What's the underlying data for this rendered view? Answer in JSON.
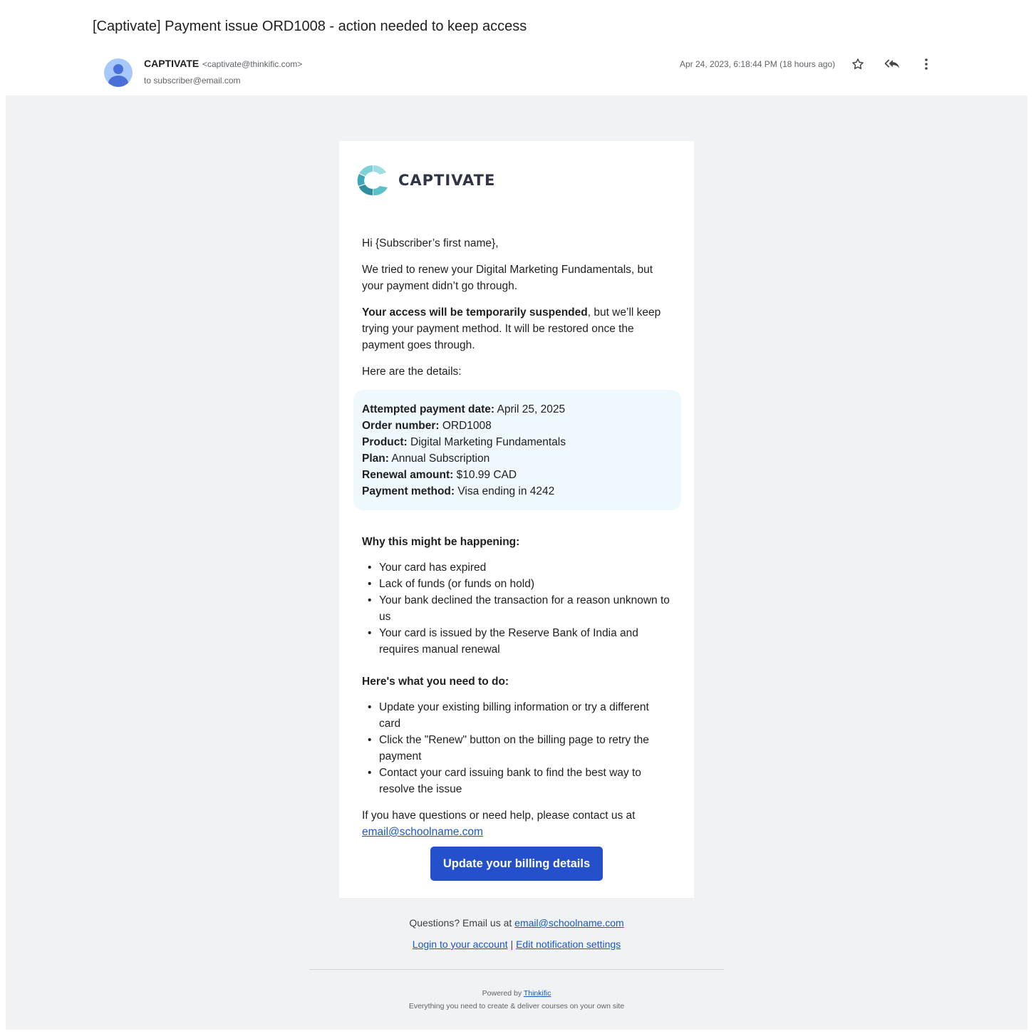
{
  "email": {
    "subject": "[Captivate] Payment issue ORD1008 - action needed to keep access",
    "sender_name": "CAPTIVATE",
    "sender_email": "<captivate@thinkific.com>",
    "to_line": "to subscriber@email.com",
    "date": "Apr 24, 2023, 6:18:44 PM (18 hours ago)",
    "icons": [
      "person-avatar-icon",
      "star-icon",
      "reply-all-icon",
      "more-vertical-icon"
    ]
  },
  "brand": {
    "name": "CAPTIVATE",
    "colors": {
      "logo_teal": "#5cc0c9",
      "logo_dark": "#2f8fa0",
      "button": "#2450cc",
      "link": "#1a56c9",
      "details_bg": "#eef8fd"
    }
  },
  "body": {
    "greeting": "Hi {Subscriber’s first name},",
    "intro": "We tried to renew your Digital Marketing Fundamentals, but your payment didn’t go through.",
    "access_bold": "Your access will be temporarily suspended",
    "access_rest": ", but we’ll keep trying your payment method. It will be restored once the payment goes through.",
    "details_intro": "Here are the details:",
    "details": [
      {
        "label": "Attempted payment date:",
        "value": " April 25, 2025"
      },
      {
        "label": "Order number:",
        "value": " ORD1008"
      },
      {
        "label": "Product:",
        "value": " Digital Marketing Fundamentals"
      },
      {
        "label": "Plan:",
        "value": " Annual Subscription"
      },
      {
        "label": "Renewal amount:",
        "value": " $10.99 CAD"
      },
      {
        "label": "Payment method:",
        "value": " Visa ending in 4242"
      }
    ],
    "why_heading": "Why this might be happening:",
    "why_items": [
      "Your card has expired",
      "Lack of funds (or funds on hold)",
      "Your bank declined the transaction for a reason unknown to us",
      "Your card is issued by the Reserve Bank of India and requires manual renewal"
    ],
    "todo_heading": "Here's what you need to do:",
    "todo_items": [
      "Update your existing billing information or try a different card",
      "Click the \"Renew\" button on the billing page to retry the payment",
      "Contact your card issuing bank to find the best way to resolve the issue"
    ],
    "help_text": "If you have questions or need help, please contact us at",
    "help_email": "email@schoolname.com",
    "cta_label": "Update your billing details"
  },
  "footer": {
    "questions_text": "Questions? Email us at ",
    "questions_email": "email@schoolname.com",
    "login_link": "Login to your account",
    "separator": " | ",
    "settings_link": "Edit notification settings",
    "powered_text": "Powered by ",
    "powered_link": "Thinkific",
    "tagline": "Everything you need to create & deliver courses on your own site"
  }
}
